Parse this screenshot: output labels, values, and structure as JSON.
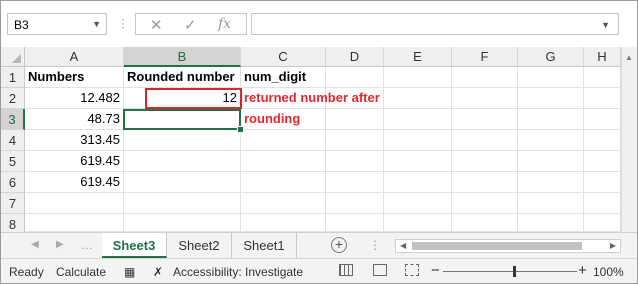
{
  "formula_bar": {
    "name_box": "B3",
    "cancel_glyph": "✕",
    "enter_glyph": "✓",
    "fx_label": "fx",
    "formula_value": ""
  },
  "columns": [
    "A",
    "B",
    "C",
    "D",
    "E",
    "F",
    "G",
    "H"
  ],
  "selected_column": "B",
  "rows": [
    "1",
    "2",
    "3",
    "4",
    "5",
    "6",
    "7",
    "8"
  ],
  "selected_row": "3",
  "cells": {
    "A1": "Numbers",
    "B1": "Rounded number",
    "C1": "num_digit",
    "A2": "12.482",
    "B2": "12",
    "A3": "48.73",
    "A4": "313.45",
    "A5": "619.45",
    "A6": "619.45"
  },
  "annotation": {
    "line1": "returned number after",
    "line2": "rounding",
    "color": "#e0292d"
  },
  "sheets": [
    "Sheet3",
    "Sheet2",
    "Sheet1"
  ],
  "active_sheet": "Sheet3",
  "status_bar": {
    "ready": "Ready",
    "calculate": "Calculate",
    "accessibility": "Accessibility: Investigate",
    "zoom": "100%",
    "zoom_minus": "−",
    "zoom_plus": "+"
  },
  "accent_color": "#217346"
}
